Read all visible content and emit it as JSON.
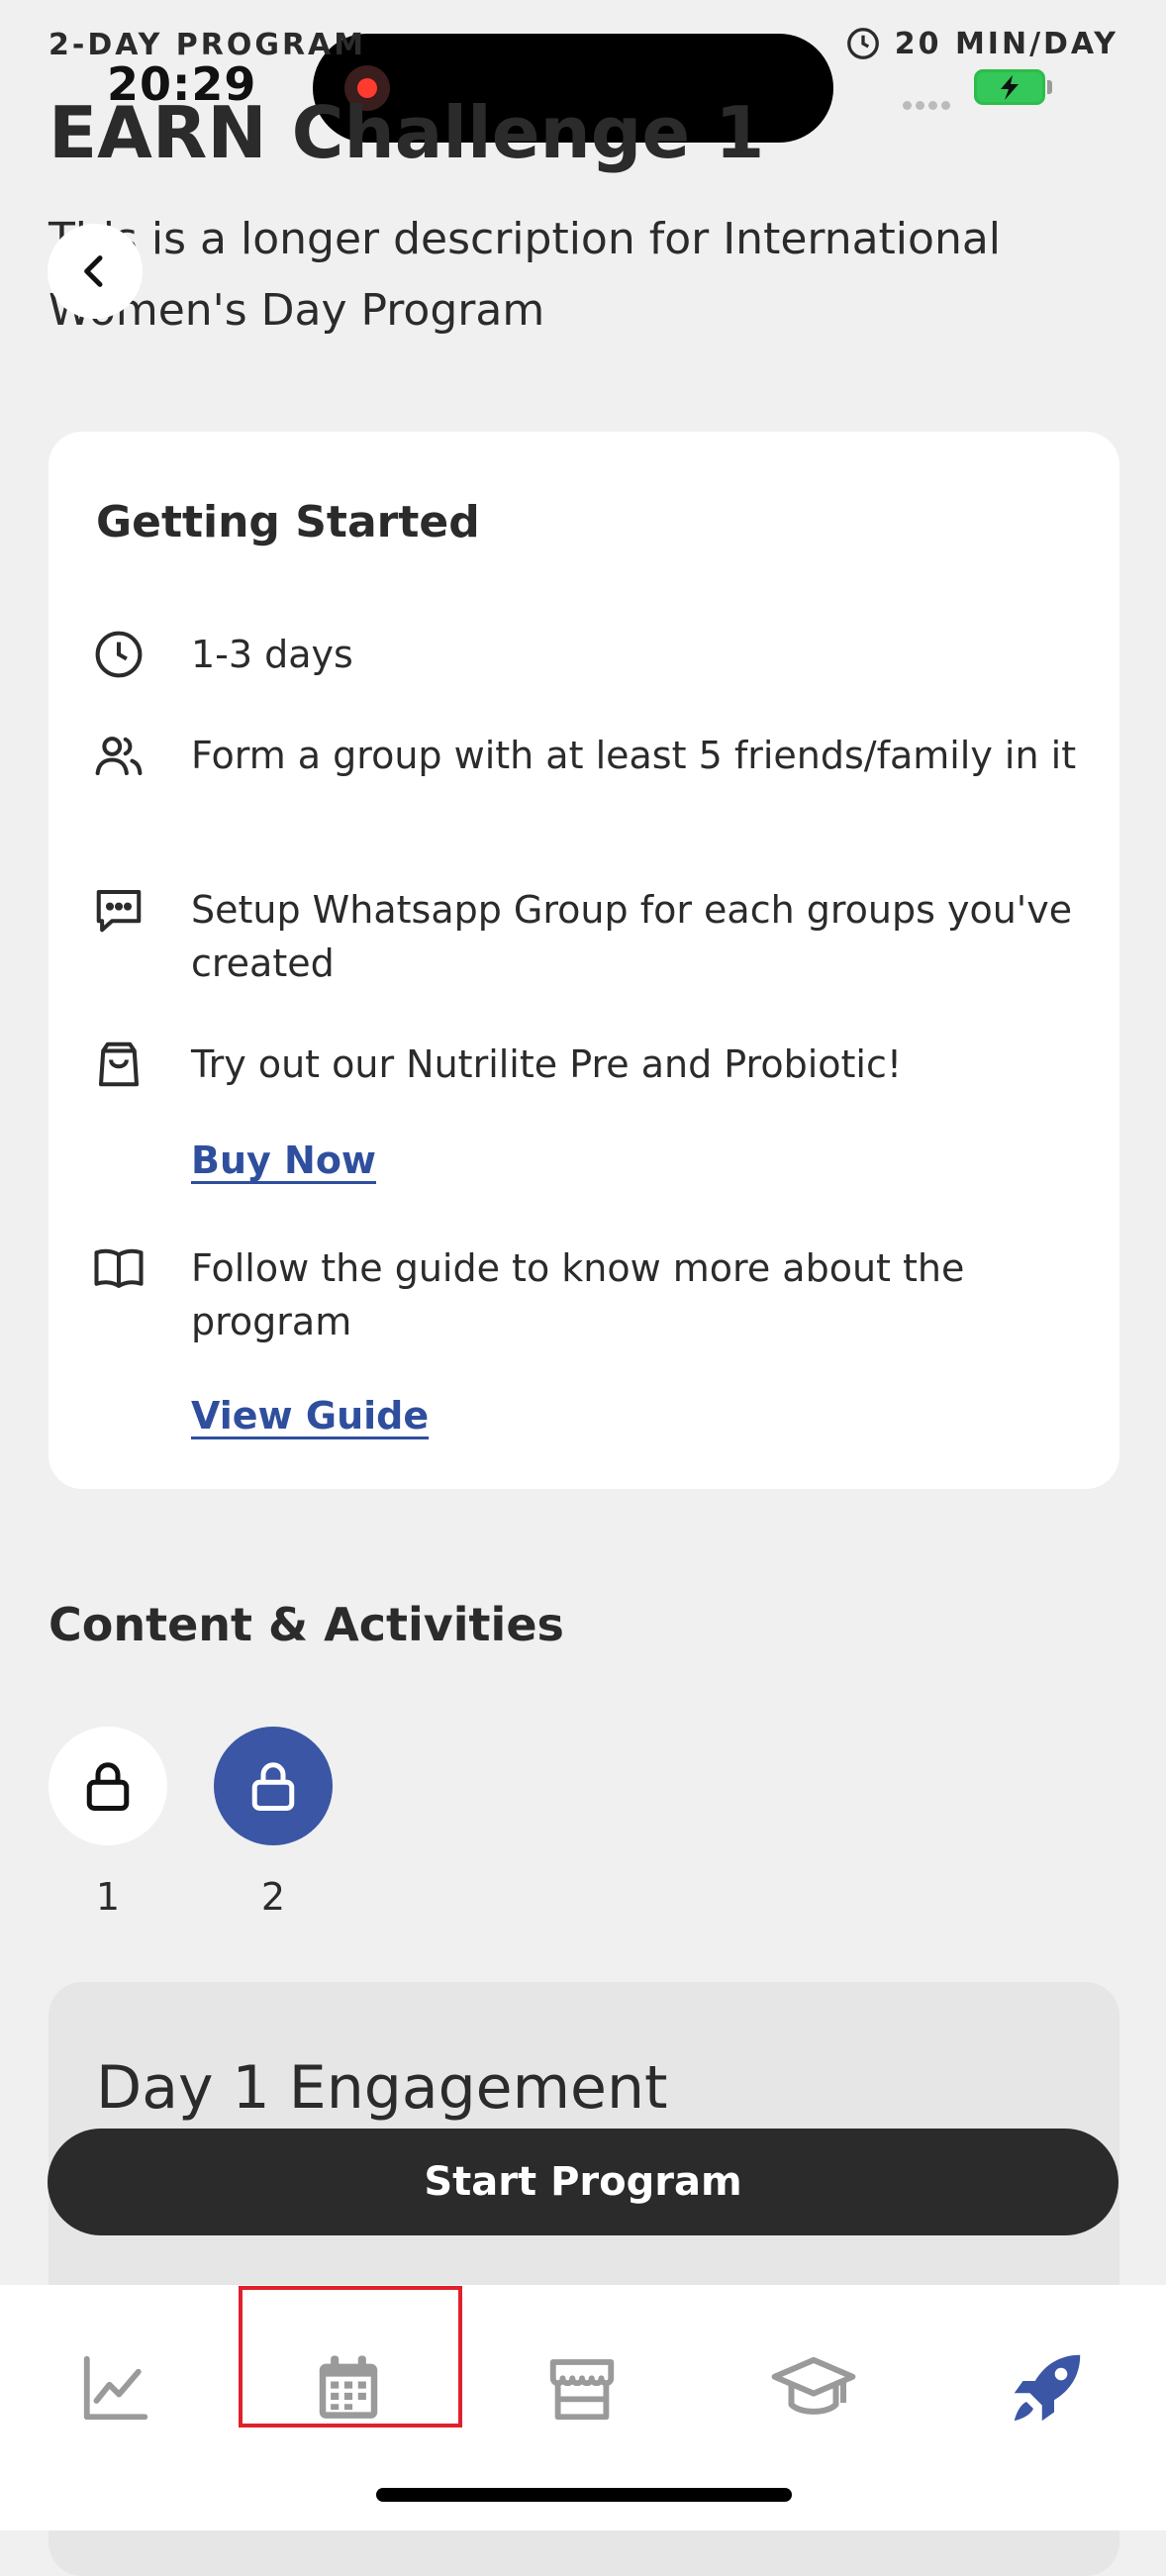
{
  "status": {
    "time": "20:29"
  },
  "header": {
    "program_tag": "2-DAY PROGRAM",
    "duration": "20 MIN/DAY",
    "title": "EARN Challenge 1",
    "description": "This is a longer description for International Women's Day Program"
  },
  "getting_started": {
    "title": "Getting Started",
    "items": [
      {
        "icon": "clock-icon",
        "text": "1-3 days"
      },
      {
        "icon": "users-icon",
        "text": "Form a group with at least 5 friends/family in it"
      },
      {
        "icon": "chat-icon",
        "text": "Setup Whatsapp Group for each groups you've created"
      },
      {
        "icon": "shopping-bag-icon",
        "text": "Try out our Nutrilite Pre and Probiotic!",
        "link": "Buy Now"
      },
      {
        "icon": "book-icon",
        "text": "Follow the guide to know more about the program",
        "link": "View Guide"
      }
    ]
  },
  "content": {
    "title": "Content & Activities",
    "days": [
      "1",
      "2"
    ]
  },
  "day_card": {
    "title": "Day 1 Engagement"
  },
  "cta": {
    "label": "Start Program"
  },
  "tabbar": {
    "tabs": [
      "chart-icon",
      "calendar-icon",
      "store-icon",
      "graduation-cap-icon",
      "rocket-icon"
    ],
    "active": "rocket-icon",
    "accent": "#3a56a4"
  }
}
